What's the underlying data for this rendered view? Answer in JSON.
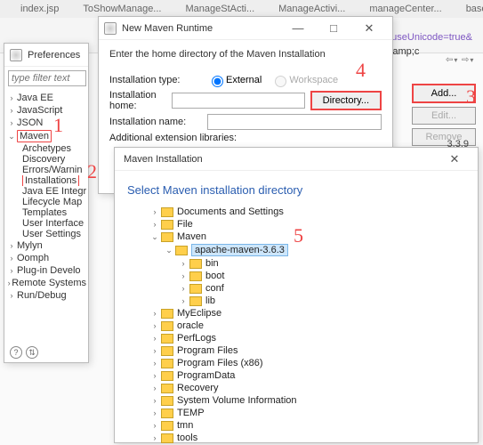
{
  "editor": {
    "tabs": [
      "index.jsp",
      "ToShowManage...",
      "ManageStActi...",
      "ManageActivi...",
      "manageCenter...",
      "baseP"
    ],
    "code_frag": "?useUnicode=true&",
    "code_amp": "&amp;"
  },
  "prefs": {
    "title": "Preferences",
    "filter_placeholder": "type filter text",
    "items_top": [
      "Java EE",
      "JavaScript",
      "JSON"
    ],
    "maven": "Maven",
    "maven_children": [
      "Archetypes",
      "Discovery",
      "Errors/Warnin",
      "Installations",
      "Java EE Integr",
      "Lifecycle Map",
      "Templates",
      "User Interface",
      "User Settings"
    ],
    "items_bottom": [
      "Mylyn",
      "Oomph",
      "Plug-in Develo",
      "Remote Systems",
      "Run/Debug"
    ]
  },
  "runtime": {
    "title": "New Maven Runtime",
    "desc": "Enter the home directory of the Maven Installation",
    "labels": {
      "type": "Installation type:",
      "home": "Installation home:",
      "name": "Installation name:",
      "ext": "Additional extension libraries:"
    },
    "radios": {
      "external": "External",
      "workspace": "Workspace"
    },
    "btn_dir": "Directory..."
  },
  "side": {
    "add": "Add...",
    "edit": "Edit...",
    "remove": "Remove",
    "version": "3.3.9"
  },
  "folder": {
    "title": "Maven Installation",
    "hdr": "Select Maven installation directory",
    "root": [
      "Documents and Settings",
      "File"
    ],
    "maven": "Maven",
    "selected": "apache-maven-3.6.3",
    "sel_children": [
      "bin",
      "boot",
      "conf",
      "lib"
    ],
    "rest": [
      "MyEclipse",
      "oracle",
      "PerfLogs",
      "Program Files",
      "Program Files (x86)",
      "ProgramData",
      "Recovery",
      "System Volume Information",
      "TEMP",
      "tmn",
      "tools"
    ]
  },
  "hints": {
    "1": "1",
    "2": "2",
    "3": "3",
    "4": "4",
    "5": "5"
  }
}
